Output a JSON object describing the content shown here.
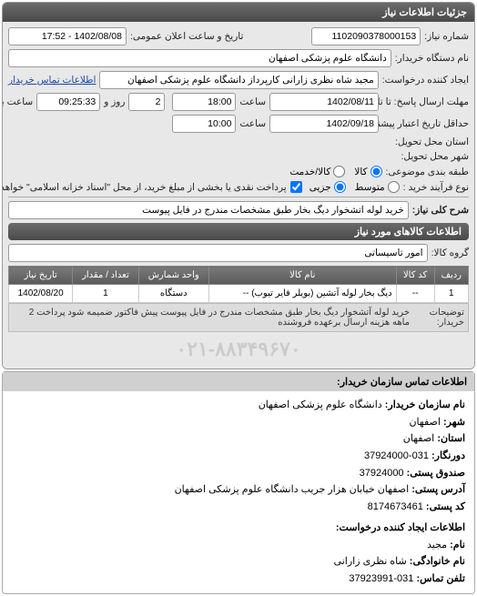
{
  "panel_title": "جزئیات اطلاعات نیاز",
  "labels": {
    "number": "شماره نیاز:",
    "announce_date": "تاریخ و ساعت اعلان عمومی:",
    "buyer_name": "نام دستگاه خریدار:",
    "requester": "ایجاد کننده درخواست:",
    "buyer_contact": "اطلاعات تماس خریدار",
    "response_deadline": "مهلت ارسال پاسخ: تا تاریخ:",
    "validity": "حداقل تاریخ اعتبار پیشنهاد: تا تاریخ:",
    "time": "ساعت",
    "days_and": "روز و",
    "time_remaining": "ساعت باقی مانده",
    "delivery_province": "استان محل تحویل:",
    "delivery_city": "شهر محل تحویل:",
    "subject_category": "طبقه بندی موضوعی:",
    "purchase_type": "نوع فرآیند خرید :",
    "general_desc": "شرح کلی نیاز:",
    "goods_info_title": "اطلاعات کالاهای مورد نیاز",
    "goods_group": "گروه کالا:"
  },
  "values": {
    "number": "1102090378000153",
    "announce_date": "1402/08/08 - 17:52",
    "buyer_name": "دانشگاه علوم پزشکی اصفهان",
    "requester": "مجید شاه نظری زارانی کارپرداز دانشگاه علوم پزشکی اصفهان",
    "deadline_date": "1402/08/11",
    "deadline_time": "18:00",
    "days_remain": "2",
    "time_remain": "09:25:33",
    "validity_date": "1402/09/18",
    "validity_time": "10:00",
    "general_desc": "خرید لوله آتشخوار دیگ بخار طبق مشخصات مندرج در فایل پیوست",
    "goods_group": "امور تاسیساتی",
    "note": "پرداخت نقدی یا بخشی از مبلغ خرید، از محل \"اسناد خزانه اسلامی\" خواهد بود."
  },
  "radios": {
    "cat": {
      "goods": "کالا",
      "service": "کالا/خدمت"
    },
    "ptype": {
      "medium": "متوسط",
      "minor": "جزیی"
    }
  },
  "table": {
    "headers": [
      "ردیف",
      "کد کالا",
      "نام کالا",
      "واحد شمارش",
      "تعداد / مقدار",
      "تاریخ نیاز"
    ],
    "row": {
      "idx": "1",
      "code": "--",
      "name": "دیگ بخار لوله آتشین (بویلر فایر تیوب) --",
      "unit": "دستگاه",
      "qty": "1",
      "date": "1402/08/20"
    }
  },
  "desc": {
    "buyer_label": "توضیحات خریدار:",
    "buyer_val": "خرید لوله آتشخوار دیگ بخار طبق مشخصات مندرج در فایل پیوست پیش فاکتور ضمیمه شود پرداخت 2 ماهه هزینه ارسال برعهده فروشنده"
  },
  "contact": {
    "header": "اطلاعات تماس سازمان خریدار:",
    "org_label": "نام سازمان خریدار:",
    "org": "دانشگاه علوم پزشکی اصفهان",
    "province_label": "شهر:",
    "province": "اصفهان",
    "city_label": "استان:",
    "city": "اصفهان",
    "fax_label": "دورنگار:",
    "fax": "031-37924000",
    "postbox_label": "صندوق پستی:",
    "postbox": "37924000",
    "address_label": "آدرس پستی:",
    "address": "اصفهان خیابان هزار جریب دانشگاه علوم پزشکی اصفهان",
    "zip_label": "کد پستی:",
    "zip": "8174673461",
    "requester_header": "اطلاعات ایجاد کننده درخواست:",
    "name_label": "نام:",
    "name": "مجید",
    "family_label": "نام خانوادگی:",
    "family": "شاه نظری زارانی",
    "phone_label": "تلفن تماس:",
    "phone": "031-37923991"
  },
  "watermark": "۰۲۱-۸۸۳۴۹۶۷۰"
}
